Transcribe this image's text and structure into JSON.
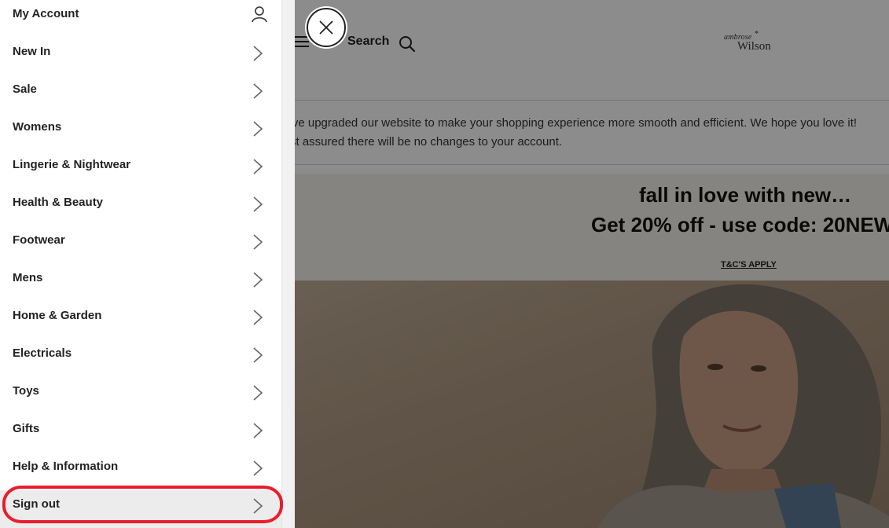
{
  "menu": {
    "account_label": "My Account",
    "account_icon": "user-icon",
    "items": [
      {
        "label": "New In"
      },
      {
        "label": "Sale"
      },
      {
        "label": "Womens"
      },
      {
        "label": "Lingerie & Nightwear"
      },
      {
        "label": "Health & Beauty"
      },
      {
        "label": "Footwear"
      },
      {
        "label": "Mens"
      },
      {
        "label": "Home & Garden"
      },
      {
        "label": "Electricals"
      },
      {
        "label": "Toys"
      },
      {
        "label": "Gifts"
      },
      {
        "label": "Help & Information"
      },
      {
        "label": "Sign out"
      }
    ],
    "highlight_color": "#e81e2e"
  },
  "header": {
    "search_label": "Search",
    "logo_line1": "ambrose",
    "logo_line2": "Wilson",
    "logo_star": "*"
  },
  "notice": {
    "line1": "'ve upgraded our website to make your shopping experience more smooth and efficient. We hope you love it!",
    "line2": "st assured there will be no changes to your account."
  },
  "promo": {
    "headline": "fall in love with new…",
    "offer": "Get 20% off - use code: 20NEW",
    "terms": "T&C'S APPLY"
  },
  "colors": {
    "overlay": "rgba(0,0,0,0.45)",
    "promo_bg": "#f5f0ea"
  }
}
